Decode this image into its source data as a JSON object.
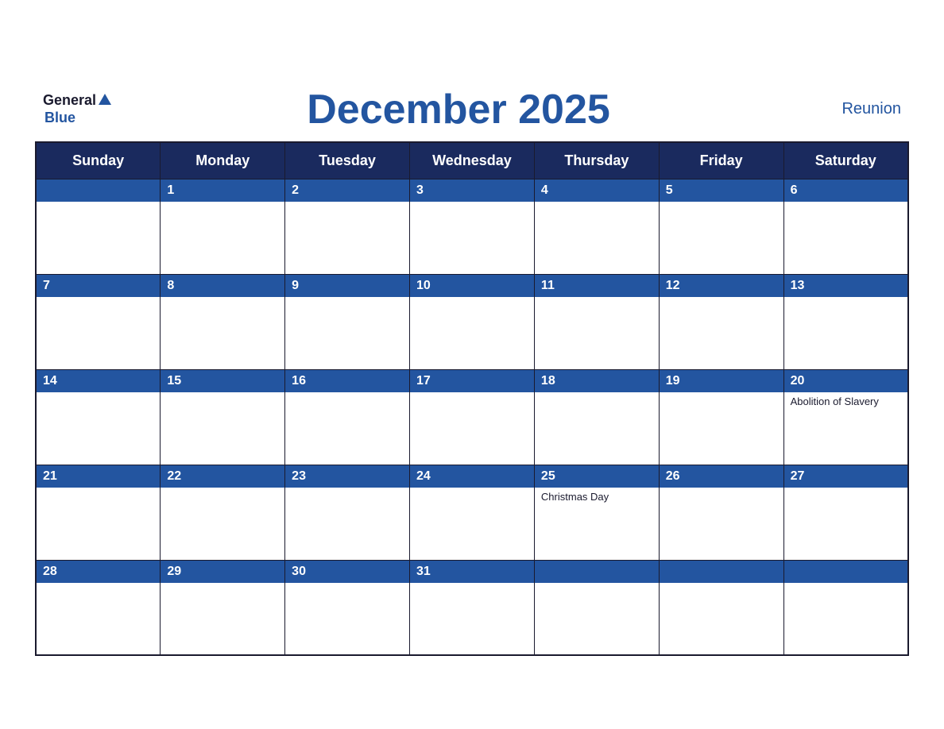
{
  "header": {
    "title": "December 2025",
    "region": "Reunion",
    "logo_general": "General",
    "logo_blue": "Blue"
  },
  "days_of_week": [
    "Sunday",
    "Monday",
    "Tuesday",
    "Wednesday",
    "Thursday",
    "Friday",
    "Saturday"
  ],
  "weeks": [
    [
      {
        "day": "",
        "holiday": ""
      },
      {
        "day": "1",
        "holiday": ""
      },
      {
        "day": "2",
        "holiday": ""
      },
      {
        "day": "3",
        "holiday": ""
      },
      {
        "day": "4",
        "holiday": ""
      },
      {
        "day": "5",
        "holiday": ""
      },
      {
        "day": "6",
        "holiday": ""
      }
    ],
    [
      {
        "day": "7",
        "holiday": ""
      },
      {
        "day": "8",
        "holiday": ""
      },
      {
        "day": "9",
        "holiday": ""
      },
      {
        "day": "10",
        "holiday": ""
      },
      {
        "day": "11",
        "holiday": ""
      },
      {
        "day": "12",
        "holiday": ""
      },
      {
        "day": "13",
        "holiday": ""
      }
    ],
    [
      {
        "day": "14",
        "holiday": ""
      },
      {
        "day": "15",
        "holiday": ""
      },
      {
        "day": "16",
        "holiday": ""
      },
      {
        "day": "17",
        "holiday": ""
      },
      {
        "day": "18",
        "holiday": ""
      },
      {
        "day": "19",
        "holiday": ""
      },
      {
        "day": "20",
        "holiday": "Abolition of Slavery"
      }
    ],
    [
      {
        "day": "21",
        "holiday": ""
      },
      {
        "day": "22",
        "holiday": ""
      },
      {
        "day": "23",
        "holiday": ""
      },
      {
        "day": "24",
        "holiday": ""
      },
      {
        "day": "25",
        "holiday": "Christmas Day"
      },
      {
        "day": "26",
        "holiday": ""
      },
      {
        "day": "27",
        "holiday": ""
      }
    ],
    [
      {
        "day": "28",
        "holiday": ""
      },
      {
        "day": "29",
        "holiday": ""
      },
      {
        "day": "30",
        "holiday": ""
      },
      {
        "day": "31",
        "holiday": ""
      },
      {
        "day": "",
        "holiday": ""
      },
      {
        "day": "",
        "holiday": ""
      },
      {
        "day": "",
        "holiday": ""
      }
    ]
  ],
  "colors": {
    "header_bg": "#1a2a5e",
    "day_bar_bg": "#2355a0",
    "border": "#1a1a2e",
    "title": "#2355a0",
    "white": "#ffffff"
  }
}
